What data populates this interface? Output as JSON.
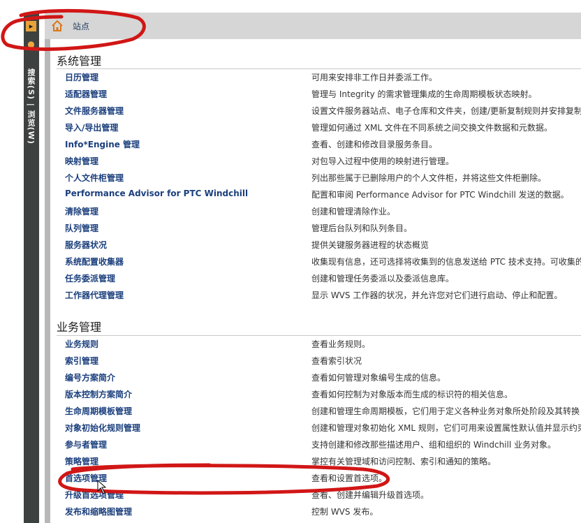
{
  "header": {
    "site_label": "站点"
  },
  "left_strip": {
    "expand_glyph": "▸",
    "pin_glyph": "●",
    "label": "搜索(S) | 浏览(W)"
  },
  "sections": [
    {
      "title": "系统管理",
      "items": [
        {
          "label": "日历管理",
          "desc": "可用来安排非工作日并委派工作。"
        },
        {
          "label": "适配器管理",
          "desc": "管理与 Integrity 的需求管理集成的生命周期模板状态映射。"
        },
        {
          "label": "文件服务器管理",
          "desc": "设置文件服务器站点、电子仓库和文件夹，创建/更新复制规则并安排复制"
        },
        {
          "label": "导入/导出管理",
          "desc": "管理如何通过 XML 文件在不同系统之间交换文件数据和元数据。"
        },
        {
          "label": "Info*Engine 管理",
          "desc": "查看、创建和修改目录服务条目。"
        },
        {
          "label": "映射管理",
          "desc": "对包导入过程中使用的映射进行管理。"
        },
        {
          "label": "个人文件柜管理",
          "desc": "列出那些属于已删除用户的个人文件柜，并将这些文件柜删除。"
        },
        {
          "label": "Performance Advisor for PTC Windchill",
          "desc": "配置和审阅 Performance Advisor for PTC Windchill 发送的数据。"
        },
        {
          "label": "清除管理",
          "desc": "创建和管理清除作业。"
        },
        {
          "label": "队列管理",
          "desc": "管理后台队列和队列条目。"
        },
        {
          "label": "服务器状况",
          "desc": "提供关键服务器进程的状态概览"
        },
        {
          "label": "系统配置收集器",
          "desc": "收集现有信息，还可选择将收集到的信息发送给 PTC 技术支持。可收集的"
        },
        {
          "label": "任务委派管理",
          "desc": "创建和管理任务委派以及委派信息库。"
        },
        {
          "label": "工作器代理管理",
          "desc": "显示 WVS 工作器的状况，并允许您对它们进行启动、停止和配置。"
        }
      ]
    },
    {
      "title": "业务管理",
      "items": [
        {
          "label": "业务规则",
          "desc": "查看业务规则。"
        },
        {
          "label": "索引管理",
          "desc": "查看索引状况"
        },
        {
          "label": "编号方案简介",
          "desc": "查看如何管理对象编号生成的信息。"
        },
        {
          "label": "版本控制方案简介",
          "desc": "查看如何控制为对象版本而生成的标识符的相关信息。"
        },
        {
          "label": "生命周期模板管理",
          "desc": "创建和管理生命周期模板，它们用于定义各种业务对象所处阶段及其转换"
        },
        {
          "label": "对象初始化规则管理",
          "desc": "创建和管理对象初始化 XML 规则，它们可用来设置属性默认值并显示约束"
        },
        {
          "label": "参与者管理",
          "desc": "支持创建和修改那些描述用户、组和组织的 Windchill 业务对象。"
        },
        {
          "label": "策略管理",
          "desc": "掌控有关管理域和访问控制、索引和通知的策略。"
        },
        {
          "label": "首选项管理",
          "desc": "查看和设置首选项。"
        },
        {
          "label": "升级首选项管理",
          "desc": "查看、创建并编辑升级首选项。"
        },
        {
          "label": "发布和缩略图管理",
          "desc": "控制 WVS 发布。"
        }
      ]
    }
  ],
  "colors": {
    "strip": "#3d4241",
    "header": "#d6d6d6",
    "link": "#1b3f7d",
    "annotation": "#d11616"
  },
  "icons": {
    "home": "home-icon",
    "expand": "expand-icon",
    "pin": "pin-icon",
    "cursor": "mouse-cursor-icon"
  }
}
